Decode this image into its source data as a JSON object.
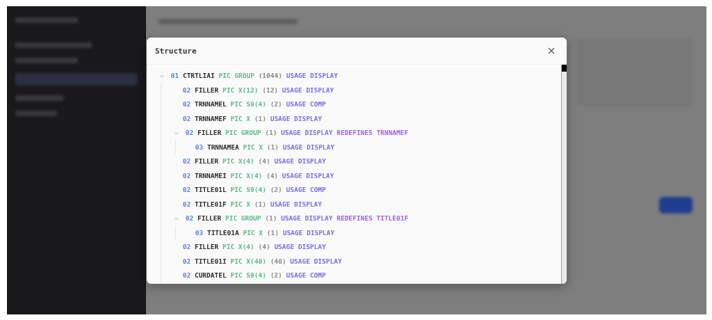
{
  "modal": {
    "title": "Structure",
    "tree": [
      {
        "level": "01",
        "name": "CTRTLIAI",
        "pic": "PIC GROUP",
        "size": "(1044)",
        "usage": "USAGE DISPLAY",
        "expanded": true,
        "children": [
          {
            "level": "02",
            "name": "FILLER",
            "pic": "PIC X(12)",
            "size": "(12)",
            "usage": "USAGE DISPLAY"
          },
          {
            "level": "02",
            "name": "TRNNAMEL",
            "pic": "PIC S9(4)",
            "size": "(2)",
            "usage": "USAGE COMP"
          },
          {
            "level": "02",
            "name": "TRNNAMEF",
            "pic": "PIC X",
            "size": "(1)",
            "usage": "USAGE DISPLAY"
          },
          {
            "level": "02",
            "name": "FILLER",
            "pic": "PIC GROUP",
            "size": "(1)",
            "usage": "USAGE DISPLAY",
            "redefines": "REDEFINES TRNNAMEF",
            "expanded": true,
            "children": [
              {
                "level": "03",
                "name": "TRNNAMEA",
                "pic": "PIC X",
                "size": "(1)",
                "usage": "USAGE DISPLAY"
              }
            ]
          },
          {
            "level": "02",
            "name": "FILLER",
            "pic": "PIC X(4)",
            "size": "(4)",
            "usage": "USAGE DISPLAY"
          },
          {
            "level": "02",
            "name": "TRNNAMEI",
            "pic": "PIC X(4)",
            "size": "(4)",
            "usage": "USAGE DISPLAY"
          },
          {
            "level": "02",
            "name": "TITLE01L",
            "pic": "PIC S9(4)",
            "size": "(2)",
            "usage": "USAGE COMP"
          },
          {
            "level": "02",
            "name": "TITLE01F",
            "pic": "PIC X",
            "size": "(1)",
            "usage": "USAGE DISPLAY"
          },
          {
            "level": "02",
            "name": "FILLER",
            "pic": "PIC GROUP",
            "size": "(1)",
            "usage": "USAGE DISPLAY",
            "redefines": "REDEFINES TITLE01F",
            "expanded": true,
            "children": [
              {
                "level": "03",
                "name": "TITLE01A",
                "pic": "PIC X",
                "size": "(1)",
                "usage": "USAGE DISPLAY"
              }
            ]
          },
          {
            "level": "02",
            "name": "FILLER",
            "pic": "PIC X(4)",
            "size": "(4)",
            "usage": "USAGE DISPLAY"
          },
          {
            "level": "02",
            "name": "TITLE01I",
            "pic": "PIC X(40)",
            "size": "(40)",
            "usage": "USAGE DISPLAY"
          },
          {
            "level": "02",
            "name": "CURDATEL",
            "pic": "PIC S9(4)",
            "size": "(2)",
            "usage": "USAGE COMP"
          }
        ]
      }
    ]
  }
}
